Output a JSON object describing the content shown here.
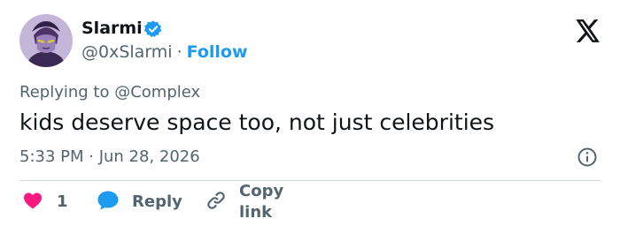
{
  "tweet": {
    "author": {
      "display_name": "Slarmi",
      "handle": "@0xSlarmi",
      "verified": true
    },
    "follow_label": "Follow",
    "separator": "·",
    "reply_context": {
      "prefix": "Replying to",
      "mention": "@Complex"
    },
    "text": "kids deserve space too, not just celebrities",
    "timestamp": "5:33 PM · Jun 28, 2026",
    "actions": {
      "like_count": "1",
      "reply_label": "Reply",
      "copy_link_label": "Copy link"
    }
  },
  "colors": {
    "accent": "#1d9bf0",
    "like": "#f91880",
    "text_primary": "#0f1419",
    "text_secondary": "#536471",
    "divider": "#cfd9de"
  },
  "icons": {
    "brand": "x-logo-icon",
    "verified": "verified-badge-icon",
    "info": "info-icon",
    "like": "heart-icon",
    "reply": "speech-bubble-icon",
    "copy_link": "link-icon"
  }
}
